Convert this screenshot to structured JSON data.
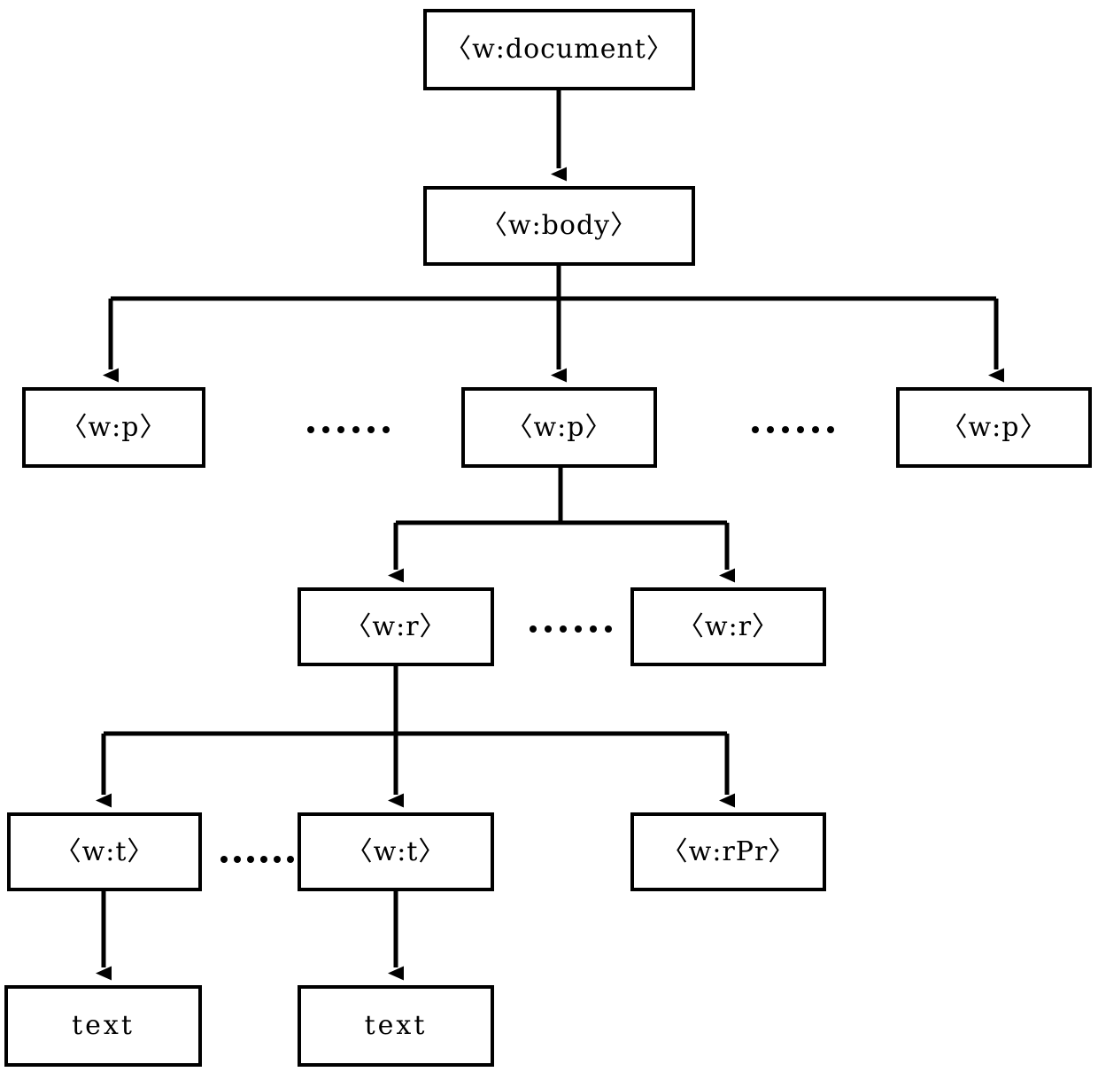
{
  "diagram": {
    "title": "OOXML WordprocessingML document element tree",
    "type": "tree",
    "line_color": "#000000",
    "box_fill": "#ffffff",
    "box_border_color": "#000000",
    "nodes": {
      "document": {
        "label": "〈w:document〉"
      },
      "body": {
        "label": "〈w:body〉"
      },
      "p_left": {
        "label": "〈w:p〉"
      },
      "p_mid": {
        "label": "〈w:p〉"
      },
      "p_right": {
        "label": "〈w:p〉"
      },
      "r_left": {
        "label": "〈w:r〉"
      },
      "r_right": {
        "label": "〈w:r〉"
      },
      "t_left": {
        "label": "〈w:t〉"
      },
      "t_mid": {
        "label": "〈w:t〉"
      },
      "rpr": {
        "label": "〈w:rPr〉"
      },
      "text_left": {
        "label": "text"
      },
      "text_mid": {
        "label": "text"
      }
    },
    "ellipses": {
      "p_row_left": {
        "dots": 6
      },
      "p_row_right": {
        "dots": 6
      },
      "r_row": {
        "dots": 6
      },
      "t_row": {
        "dots": 6
      }
    }
  }
}
